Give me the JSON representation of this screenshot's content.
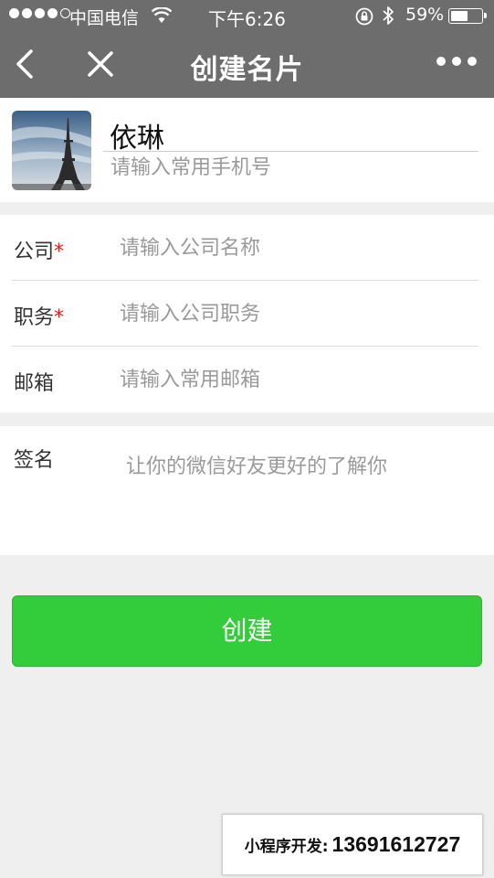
{
  "status_bar": {
    "carrier": "中国电信",
    "time": "下午6:26",
    "battery_percent": "59%",
    "battery_level": 0.59
  },
  "nav": {
    "title": "创建名片",
    "back_icon": "chevron-left-icon",
    "close_icon": "close-icon",
    "more_icon": "more-dots-icon"
  },
  "profile": {
    "name": "依琳",
    "phone_placeholder": "请输入常用手机号",
    "avatar_icon": "eiffel-tower-photo"
  },
  "form": {
    "fields": [
      {
        "label": "公司",
        "required": true,
        "placeholder": "请输入公司名称"
      },
      {
        "label": "职务",
        "required": true,
        "placeholder": "请输入公司职务"
      },
      {
        "label": "邮箱",
        "required": false,
        "placeholder": "请输入常用邮箱"
      }
    ],
    "required_mark": "*"
  },
  "signature": {
    "label": "签名",
    "placeholder": "让你的微信好友更好的了解你"
  },
  "create_button": {
    "label": "创建",
    "color": "#33cc3a"
  },
  "promo": {
    "label": "小程序开发:",
    "phone": "13691612727"
  },
  "colors": {
    "nav_bg": "#6d6d6d",
    "page_bg": "#efefef",
    "required": "#e02020"
  }
}
